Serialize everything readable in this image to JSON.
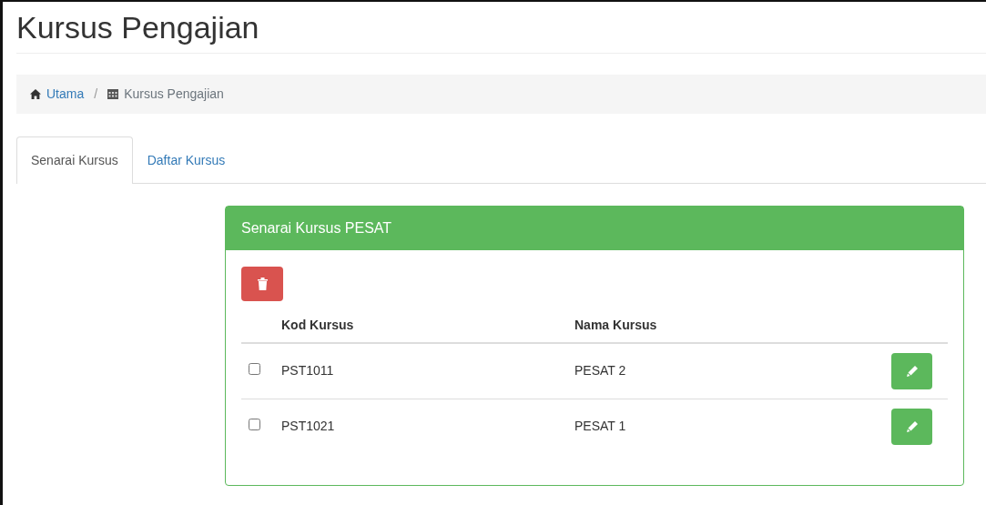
{
  "page_title": "Kursus Pengajian",
  "breadcrumb": [
    {
      "label": "Utama",
      "kind": "link"
    },
    {
      "separator": "/",
      "label": "Kursus Pengajian",
      "kind": "current"
    }
  ],
  "tabs": [
    {
      "label": "Senarai Kursus",
      "selected": true
    },
    {
      "label": "Daftar Kursus",
      "selected": false
    }
  ],
  "panel": {
    "title": "Senarai Kursus PESAT",
    "columns": [
      "Kod Kursus",
      "Nama Kursus"
    ],
    "rows": [
      {
        "code": "PST1011",
        "name": "PESAT 2",
        "checked": false
      },
      {
        "code": "PST1021",
        "name": "PESAT 1",
        "checked": false
      }
    ]
  }
}
